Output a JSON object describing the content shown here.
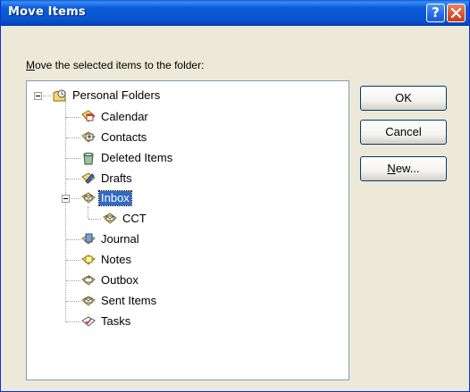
{
  "window": {
    "title": "Move Items",
    "help_glyph": "?",
    "close_icon": "close-icon"
  },
  "prompt": {
    "mnemonic": "M",
    "rest": "ove the selected items to the folder:"
  },
  "tree": {
    "root": {
      "label": "Personal Folders",
      "icon": "personal-folders-icon",
      "expanded": true
    },
    "items": [
      {
        "label": "Calendar",
        "icon": "calendar-folder-icon"
      },
      {
        "label": "Contacts",
        "icon": "contacts-folder-icon"
      },
      {
        "label": "Deleted Items",
        "icon": "deleted-items-icon"
      },
      {
        "label": "Drafts",
        "icon": "drafts-folder-icon"
      },
      {
        "label": "Inbox",
        "icon": "inbox-folder-icon",
        "selected": true,
        "expanded": true
      },
      {
        "label": "CCT",
        "icon": "mail-folder-icon"
      },
      {
        "label": "Journal",
        "icon": "journal-folder-icon"
      },
      {
        "label": "Notes",
        "icon": "notes-folder-icon"
      },
      {
        "label": "Outbox",
        "icon": "outbox-folder-icon"
      },
      {
        "label": "Sent Items",
        "icon": "sent-items-icon"
      },
      {
        "label": "Tasks",
        "icon": "tasks-folder-icon"
      }
    ]
  },
  "buttons": {
    "ok": "OK",
    "cancel": "Cancel",
    "new_mnemonic": "N",
    "new_rest": "ew..."
  },
  "colors": {
    "titlebar": "#0a55cf",
    "dialog_bg": "#ece9d8",
    "selection": "#316ac5",
    "close_button": "#d8532c"
  }
}
